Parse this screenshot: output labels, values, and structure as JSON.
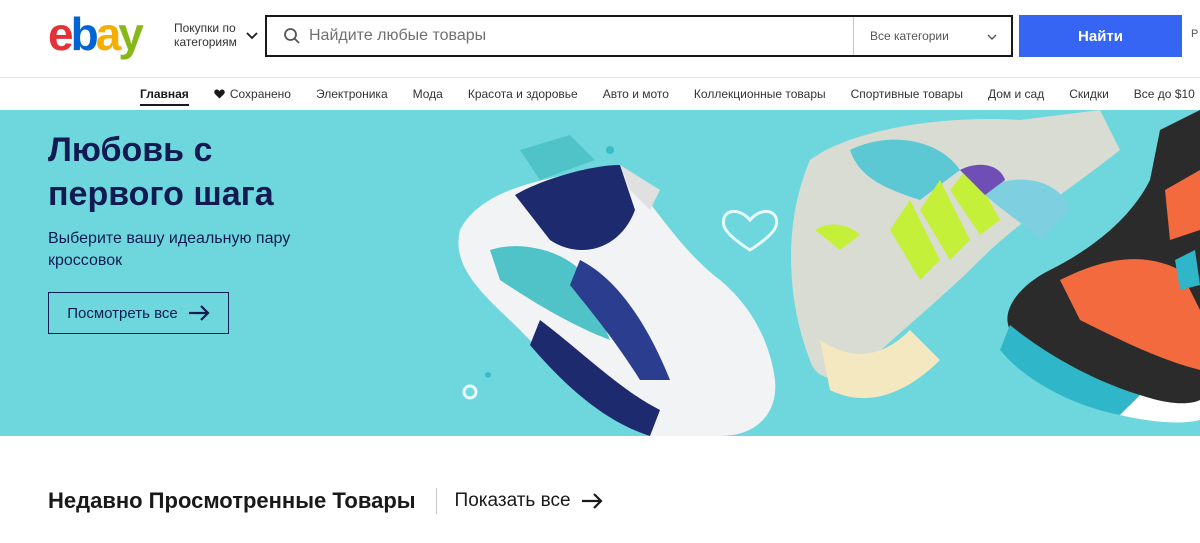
{
  "header": {
    "shop_by_category": "Покупки по категориям",
    "search_placeholder": "Найдите любые товары",
    "category_select": "Все категории",
    "search_button": "Найти",
    "advanced_link": "Р"
  },
  "nav": {
    "items": [
      {
        "label": "Главная",
        "active": true
      },
      {
        "label": "Сохранено",
        "icon": "heart-icon"
      },
      {
        "label": "Электроника"
      },
      {
        "label": "Мода"
      },
      {
        "label": "Красота и здоровье"
      },
      {
        "label": "Авто и мото"
      },
      {
        "label": "Коллекционные товары"
      },
      {
        "label": "Спортивные товары"
      },
      {
        "label": "Дом и сад"
      },
      {
        "label": "Скидки"
      },
      {
        "label": "Все до $10"
      }
    ]
  },
  "hero": {
    "title": "Любовь с первого шага",
    "subtitle": "Выберите вашу идеальную пару кроссовок",
    "button": "Посмотреть все",
    "background": "#6ed7dd"
  },
  "recently_viewed": {
    "title": "Недавно Просмотренные Товары",
    "link": "Показать все"
  },
  "colors": {
    "ebay_red": "#e53238",
    "ebay_blue": "#0064d2",
    "ebay_yellow": "#f5af02",
    "ebay_green": "#86b817",
    "primary_button": "#3665f3",
    "hero_text": "#121a52"
  }
}
